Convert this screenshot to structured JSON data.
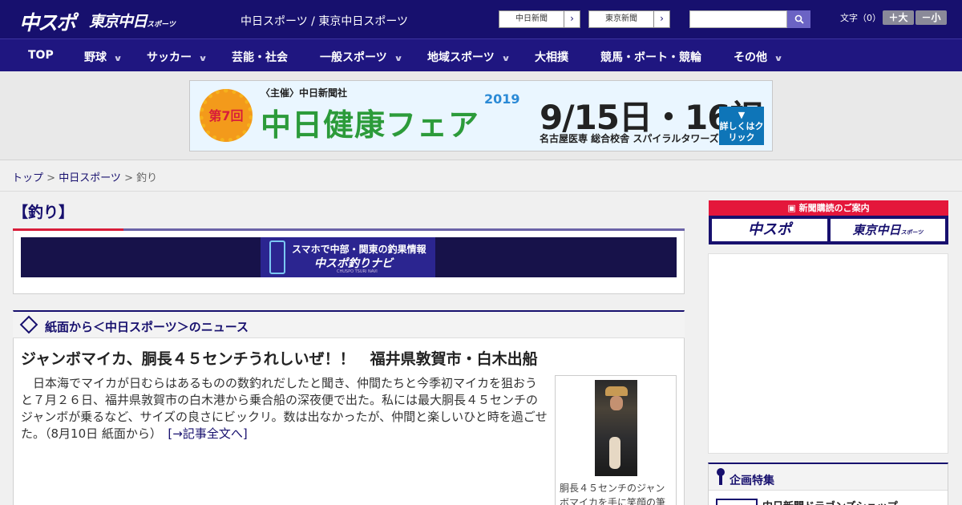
{
  "header": {
    "logo_chunichi_sports": "中スポ",
    "logo_tokyo_chunichi": "東京中日",
    "logo_tokyo_chunichi_small": "スポーツ",
    "site_links": "中日スポーツ / 東京中日スポーツ",
    "paper_buttons": [
      "中日新聞",
      "東京新聞"
    ],
    "search_icon": "search-icon",
    "font_size_label": "文字（0）",
    "font_larger": "＋大",
    "font_smaller": "－小"
  },
  "nav": {
    "items": [
      {
        "label": "TOP"
      },
      {
        "label": "野球"
      },
      {
        "label": "サッカー"
      },
      {
        "label": "芸能・社会"
      },
      {
        "label": "一般スポーツ"
      },
      {
        "label": "地域スポーツ"
      },
      {
        "label": "大相撲"
      },
      {
        "label": "競馬・ボート・競輪"
      },
      {
        "label": "その他"
      }
    ]
  },
  "banner": {
    "badge": "第7回",
    "host": "〈主催〉中日新聞社",
    "title": "中日健康フェア",
    "year": "2019",
    "date": "9/15日・16祝",
    "venue": "名古屋医専 総合校舎 スパイラルタワーズ",
    "detail_button": "詳しくはクリック"
  },
  "breadcrumb": {
    "home": "トップ",
    "sep": " > ",
    "parent": "中日スポーツ",
    "current": "釣り"
  },
  "section": {
    "title": "【釣り】",
    "navi_text1": "スマホで中部・関東の釣果情報",
    "navi_text2": "中スポ釣りナビ",
    "navi_text3": "CHUSPO TSURI NAVI"
  },
  "news": {
    "panel_title": "紙面から＜中日スポーツ＞のニュース",
    "article_title": "ジャンボマイカ、胴長４５センチうれしいぜ！！　福井県敦賀市・白木出船",
    "article_body": "日本海でマイカが日むらはあるものの数釣れだしたと聞き、仲間たちと今季初マイカを狙おうと７月２６日、福井県敦賀市の白木港から乗合船の深夜便で出た。私には最大胴長４５センチのジャンボが乗るなど、サイズの良さにビックリ。数は出なかったが、仲間と楽しいひと時を過ごせた。（8月10日 紙面から）",
    "read_more": "[→記事全文へ]",
    "photo_caption": "胴長４５センチのジャンボマイカを手に笑顔の筆"
  },
  "sidebar": {
    "subscribe_head": "新聞購読のご案内",
    "subscribe_logo1": "中スポ",
    "subscribe_logo2": "東京中日",
    "subscribe_logo2_small": "スポーツ",
    "feature_title": "企画特集",
    "feature_item": "中日新聞ドラゴンズショップ"
  }
}
